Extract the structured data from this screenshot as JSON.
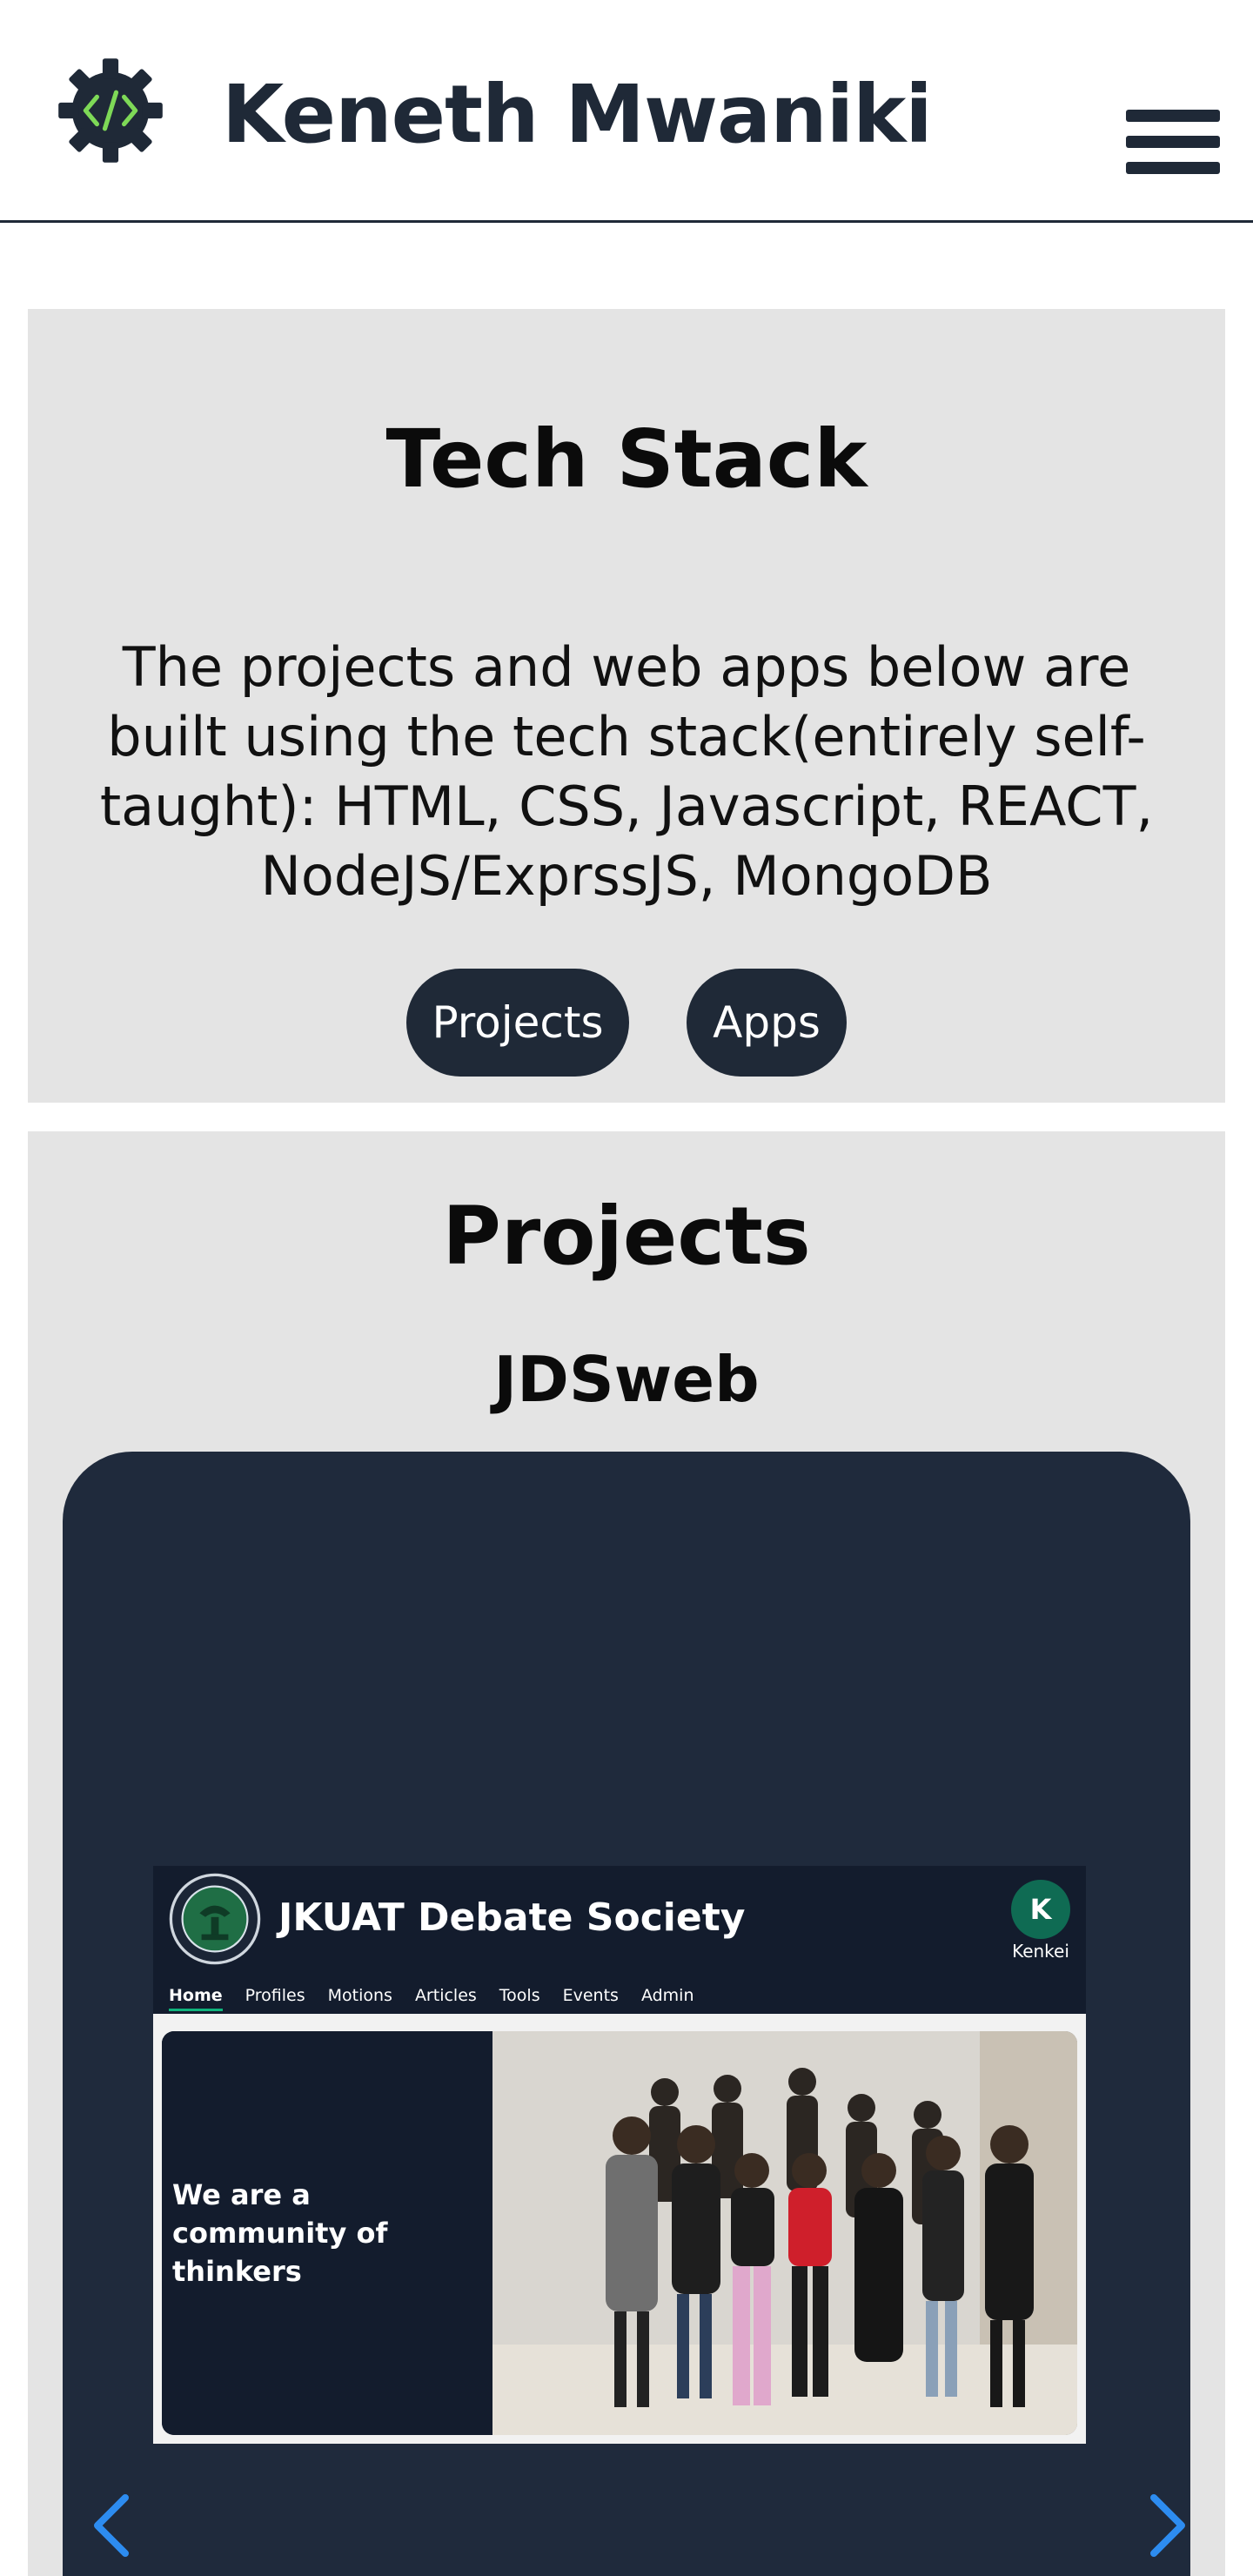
{
  "header": {
    "brand": "Keneth Mwaniki",
    "logo_icon": "code-gear-icon",
    "menu_icon": "hamburger-menu-icon"
  },
  "tech_stack": {
    "title": "Tech Stack",
    "description": "The projects and web apps below are built using the tech stack(entirely self-taught): HTML, CSS, Javascript, REACT, NodeJS/ExprssJS, MongoDB",
    "buttons": {
      "projects": "Projects",
      "apps": "Apps"
    }
  },
  "projects": {
    "title": "Projects",
    "current_project": "JDSweb",
    "screenshot": {
      "site_title": "JKUAT Debate Society",
      "avatar_letter": "K",
      "user_name": "Kenkei",
      "nav": [
        "Home",
        "Profiles",
        "Motions",
        "Articles",
        "Tools",
        "Events",
        "Admin"
      ],
      "hero_text": "We are a community of thinkers"
    }
  },
  "colors": {
    "primary_dark": "#1f2937",
    "accent_green": "#7ed957",
    "card_bg": "#e4e4e4",
    "carousel_bg": "#1f2a3c",
    "arrow_blue": "#2d8cf0"
  }
}
